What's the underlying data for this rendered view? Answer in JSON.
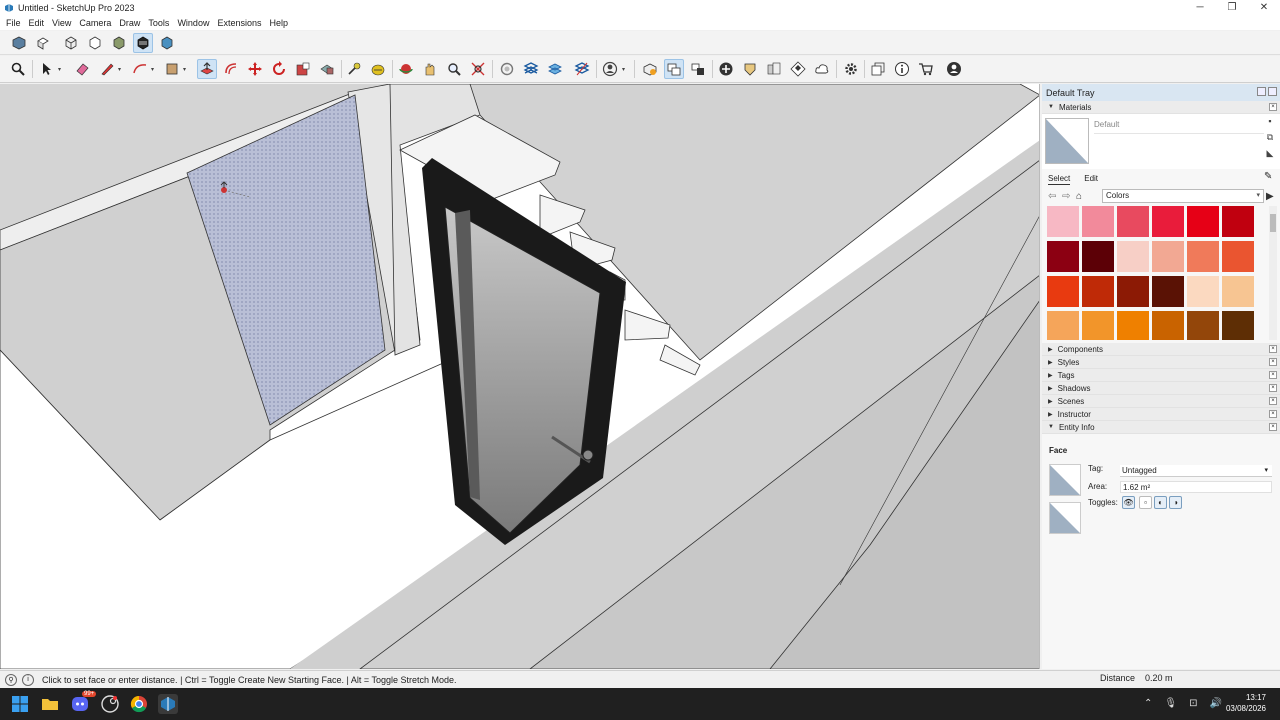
{
  "window": {
    "title": "Untitled - SketchUp Pro 2023",
    "controls": [
      "minimize-icon",
      "restore-icon",
      "close-icon"
    ]
  },
  "menu": [
    "File",
    "Edit",
    "View",
    "Camera",
    "Draw",
    "Tools",
    "Window",
    "Extensions",
    "Help"
  ],
  "toolbar_top": [
    "iso-view-icon",
    "top-view-icon",
    "front-view-icon",
    "right-view-icon",
    "back-view-icon",
    "bottom-view-icon",
    "left-view-icon"
  ],
  "toolbar_main": [
    "search-icon",
    "select-icon",
    "eraser-icon",
    "pencil-icon",
    "arc-icon",
    "rectangle-icon",
    "push-pull-icon",
    "offset-icon",
    "move-icon",
    "rotate-icon",
    "scale-icon",
    "follow-me-icon",
    "tape-measure-icon",
    "paint-bucket-icon",
    "orbit-icon",
    "pan-icon",
    "zoom-icon",
    "zoom-extents-icon",
    "3d-warehouse-icon",
    "layers-icon",
    "layers-2-icon",
    "section-icon",
    "user-account-icon",
    "components-icon",
    "styles-icon",
    "scenes-icon",
    "add-location-icon",
    "geo-icon",
    "extension-warehouse-icon",
    "checker-icon",
    "cloud-icon",
    "settings-icon",
    "outliner-icon",
    "info-icon",
    "cart-icon",
    "profile-icon"
  ],
  "tray": {
    "title": "Default Tray",
    "materials": {
      "header": "Materials",
      "current_name": "Default",
      "tabs": [
        "Select",
        "Edit"
      ],
      "collection": "Colors",
      "swatches": [
        "#f7b8c4",
        "#f28a9b",
        "#e84a5f",
        "#e91c3b",
        "#e60016",
        "#c0000f",
        "#8c0012",
        "#5c0006",
        "#f7cfc6",
        "#f2a893",
        "#f07a5a",
        "#ea5530",
        "#e83a10",
        "#bf2a07",
        "#8c1a05",
        "#5a1205",
        "#fbd9c0",
        "#f7c592",
        "#f5a55a",
        "#f2952a",
        "#ef8000",
        "#c96300",
        "#93460a",
        "#5e2e05"
      ]
    },
    "panels": [
      "Components",
      "Styles",
      "Tags",
      "Shadows",
      "Scenes",
      "Instructor",
      "Entity Info"
    ],
    "entity_info": {
      "type": "Face",
      "tag_label": "Tag:",
      "tag_value": "Untagged",
      "area_label": "Area:",
      "area_value": "1.62 m²",
      "toggles_label": "Toggles:"
    }
  },
  "status": {
    "message": "Click to set face or enter distance. | Ctrl = Toggle Create New Starting Face. | Alt = Toggle Stretch Mode.",
    "measure_label": "Distance",
    "measure_value": "0.20 m"
  },
  "taskbar": {
    "time": "13:17",
    "date": "03/08/2026",
    "badge": "99+"
  }
}
